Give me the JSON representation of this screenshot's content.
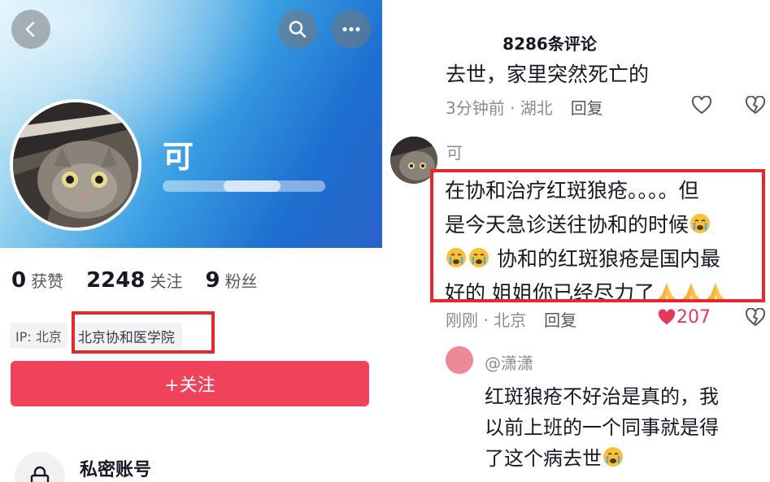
{
  "profile": {
    "name": "可",
    "stats": [
      {
        "num": "0",
        "label": "获赞"
      },
      {
        "num": "2248",
        "label": "关注"
      },
      {
        "num": "9",
        "label": "粉丝"
      }
    ],
    "ip_label": "IP: 北京",
    "school": "北京协和医学院",
    "follow_label": "+关注",
    "private_title": "私密账号"
  },
  "comments_panel": {
    "title": "8286条评论",
    "prev_comment": {
      "text": "去世，家里突然死亡的",
      "time": "3分钟前 · 湖北",
      "reply": "回复"
    },
    "main_comment": {
      "user": "可",
      "line1": "在协和治疗红斑狼疮。。。。但",
      "line2": "是今天急诊送往协和的时候",
      "line3": " 协和的红斑狼疮是国内最",
      "line4": "好的 姐姐你已经尽力了",
      "time": "刚刚 · 北京",
      "reply": "回复",
      "likes": "207"
    },
    "reply_comment": {
      "user": "@潇潇",
      "line1": "红斑狼疮不好治是真的，我",
      "line2": "以前上班的一个同事就是得",
      "line3": "了这个病去世"
    }
  },
  "colors": {
    "accent_red": "#f0425b",
    "highlight_box": "#e8262d",
    "like_red": "#e8385a"
  },
  "icons": [
    "back-arrow-icon",
    "search-icon",
    "more-dots-icon",
    "lock-icon",
    "heart-icon",
    "dislike-heart-icon",
    "crying-face-emoji",
    "praying-hands-emoji"
  ]
}
